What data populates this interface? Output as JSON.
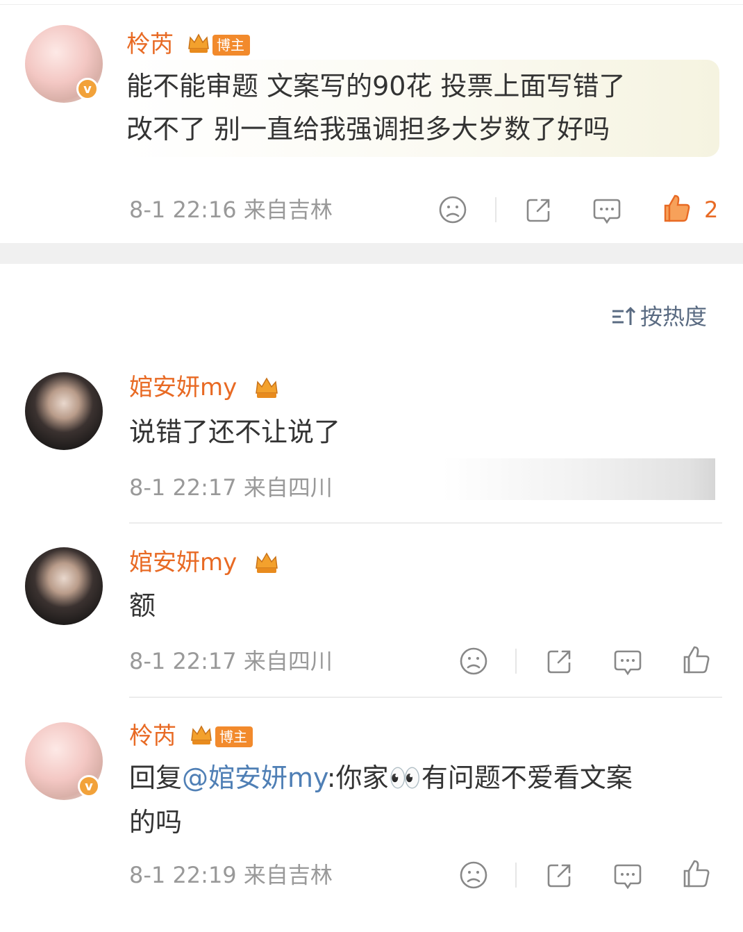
{
  "post": {
    "author": "柃芮",
    "blogger_tag": "博主",
    "text_line1": "能不能审题 文案写的90花 投票上面写错了",
    "text_line2": "改不了 别一直给我强调担多大岁数了好吗",
    "time_location": "8-1 22:16  来自吉林",
    "like_count": "2"
  },
  "sort": {
    "label": "按热度"
  },
  "comments": [
    {
      "author": "婠安妍my",
      "text": "说错了还不让说了",
      "time_location": "8-1 22:17  来自四川"
    },
    {
      "author": "婠安妍my",
      "text": "额",
      "time_location": "8-1 22:17  来自四川"
    },
    {
      "author": "柃芮",
      "blogger_tag": "博主",
      "reply_prefix": "回复",
      "mention": "@婠安妍my",
      "text_after": ":你家👀有问题不爱看文案",
      "text_line2": "的吗",
      "time_location": "8-1 22:19  来自吉林"
    }
  ],
  "colors": {
    "accent": "#e86a24",
    "mention": "#4f7fb5",
    "meta": "#999999"
  },
  "icons": [
    "sad-face-icon",
    "share-icon",
    "comment-icon",
    "thumbs-up-icon",
    "sort-icon",
    "crown-badge-icon"
  ]
}
